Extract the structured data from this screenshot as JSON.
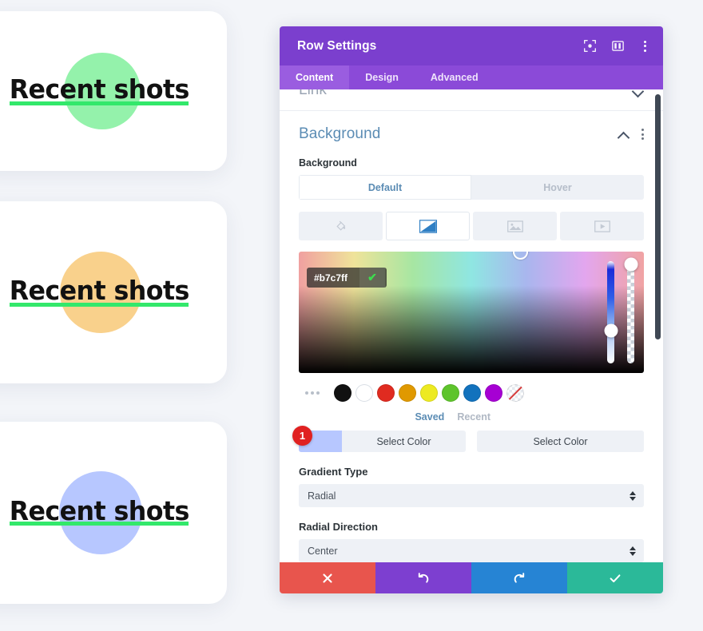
{
  "preview": {
    "cards": [
      {
        "title": "Recent shots",
        "blob_color": "#94f2ab",
        "underline_color": "#33e86b"
      },
      {
        "title": "Recent shots",
        "blob_color": "#f9d18c",
        "underline_color": "#33e86b"
      },
      {
        "title": "Recent shots",
        "blob_color": "#b7c7ff",
        "underline_color": "#33e86b"
      }
    ]
  },
  "panel": {
    "header": {
      "title": "Row Settings",
      "icons": [
        "target-icon",
        "layout-columns-icon",
        "more-vertical-icon"
      ],
      "background_color": "#7b3fce"
    },
    "tabs": [
      {
        "label": "Content",
        "active": true
      },
      {
        "label": "Design",
        "active": false
      },
      {
        "label": "Advanced",
        "active": false
      }
    ],
    "clipped_section": {
      "title": "Link"
    },
    "background_section": {
      "title": "Background",
      "field_label": "Background",
      "state_toggle": [
        {
          "label": "Default",
          "active": true
        },
        {
          "label": "Hover",
          "active": false
        }
      ],
      "type_buttons": [
        {
          "name": "color-fill-icon",
          "active": false
        },
        {
          "name": "gradient-icon",
          "active": true
        },
        {
          "name": "image-icon",
          "active": false
        },
        {
          "name": "video-icon",
          "active": false
        }
      ],
      "color_picker": {
        "hex_value": "#b7c7ff",
        "confirm_label": "✔",
        "hue_handle_percent": 68,
        "alpha_handle_percent": 3,
        "cursor_x_percent": 64
      },
      "swatches": [
        {
          "name": "swatch-black",
          "color": "#111111"
        },
        {
          "name": "swatch-white",
          "color": "#ffffff"
        },
        {
          "name": "swatch-red",
          "color": "#e02b20"
        },
        {
          "name": "swatch-orange",
          "color": "#e09900"
        },
        {
          "name": "swatch-yellow",
          "color": "#edea21"
        },
        {
          "name": "swatch-green",
          "color": "#5ec42c"
        },
        {
          "name": "swatch-blue",
          "color": "#1272bd"
        },
        {
          "name": "swatch-purple",
          "color": "#a600d3"
        },
        {
          "name": "swatch-transparent",
          "color": "transparent"
        }
      ],
      "swatch_tabs": [
        {
          "label": "Saved",
          "active": true
        },
        {
          "label": "Recent",
          "active": false
        }
      ],
      "gradient_stops": [
        {
          "badge": "1",
          "chip_color": "#b7c7ff",
          "button_label": "Select Color"
        },
        {
          "badge": "",
          "chip_color": "",
          "button_label": "Select Color"
        }
      ],
      "gradient_type": {
        "label": "Gradient Type",
        "value": "Radial"
      },
      "radial_direction": {
        "label": "Radial Direction",
        "value": "Center"
      }
    },
    "footer": [
      {
        "name": "cancel-button",
        "icon": "close-icon",
        "color": "#e8554d"
      },
      {
        "name": "undo-button",
        "icon": "undo-icon",
        "color": "#7d3fd0"
      },
      {
        "name": "redo-button",
        "icon": "redo-icon",
        "color": "#2684d4"
      },
      {
        "name": "save-button",
        "icon": "check-icon",
        "color": "#2bb999"
      }
    ]
  }
}
